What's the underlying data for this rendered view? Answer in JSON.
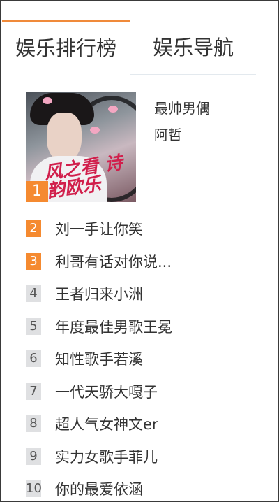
{
  "tabs": [
    {
      "label": "娱乐排行榜",
      "active": true
    },
    {
      "label": "娱乐导航",
      "active": false
    }
  ],
  "feature": {
    "rank": "1",
    "title": "最帅男偶",
    "subtitle": "阿哲",
    "image_text": "风之看 诗韵欧乐"
  },
  "list": [
    {
      "rank": "2",
      "label": "刘一手让你笑",
      "hot": true
    },
    {
      "rank": "3",
      "label": "利哥有话对你说...",
      "hot": true
    },
    {
      "rank": "4",
      "label": "王者归来小洲",
      "hot": false
    },
    {
      "rank": "5",
      "label": "年度最佳男歌王冕",
      "hot": false
    },
    {
      "rank": "6",
      "label": "知性歌手若溪",
      "hot": false
    },
    {
      "rank": "7",
      "label": "一代天骄大嘎子",
      "hot": false
    },
    {
      "rank": "8",
      "label": "超人气女神文er",
      "hot": false
    },
    {
      "rank": "9",
      "label": "实力女歌手菲儿",
      "hot": false
    },
    {
      "rank": "10",
      "label": "你的最爱依涵",
      "hot": false
    }
  ],
  "colors": {
    "accent": "#f58a30",
    "tab_border": "#f08a3a",
    "badge_cold": "#dfe0e2",
    "text": "#333333"
  }
}
